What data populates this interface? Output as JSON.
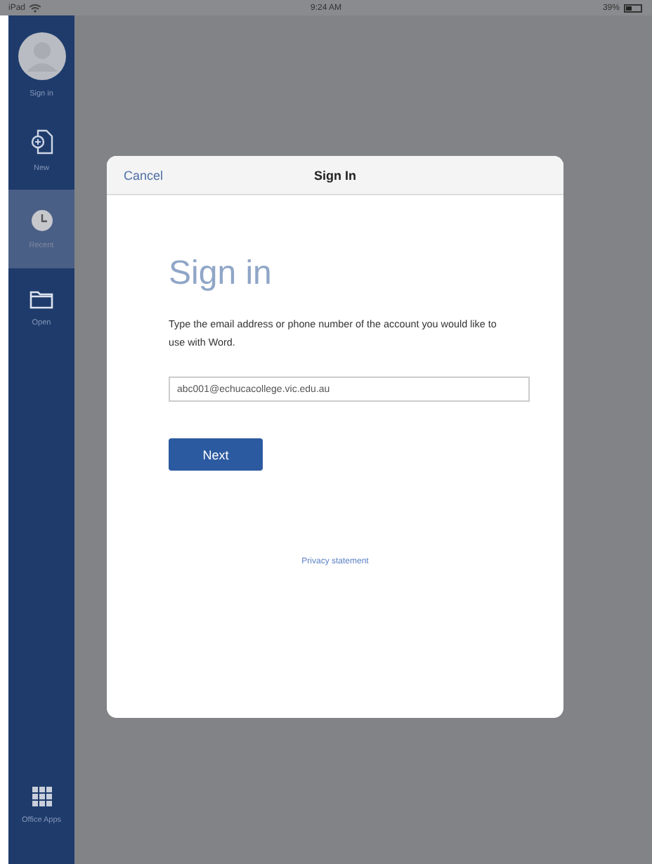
{
  "status_bar": {
    "device": "iPad",
    "time": "9:24 AM",
    "battery": "39%"
  },
  "sidebar": {
    "items": [
      {
        "kind": "account",
        "label": "Sign in",
        "selected": false
      },
      {
        "kind": "new",
        "label": "New",
        "selected": false
      },
      {
        "kind": "recent",
        "label": "Recent",
        "selected": true
      },
      {
        "kind": "open",
        "label": "Open",
        "selected": false
      }
    ],
    "footer": {
      "kind": "apps",
      "label": "Office Apps"
    }
  },
  "dialog": {
    "cancel": "Cancel",
    "title": "Sign In",
    "heading": "Sign in",
    "instructions": "Type the email address or phone number of the account you would like to use with Word.",
    "email": "abc001@echucacollege.vic.edu.au",
    "next": "Next",
    "privacy": "Privacy statement"
  }
}
